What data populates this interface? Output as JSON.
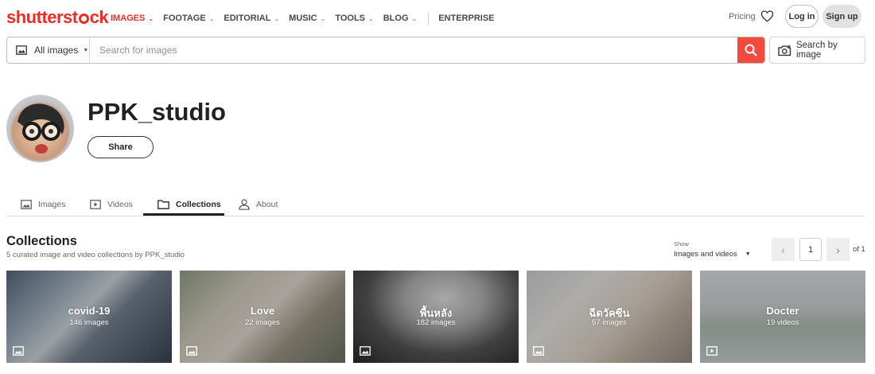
{
  "brand": {
    "logo_text_a": "shutterst",
    "logo_text_b": "ck",
    "accent": "#ee2b24"
  },
  "nav": {
    "items": [
      {
        "label": "IMAGES",
        "has_dropdown": true,
        "active": true
      },
      {
        "label": "FOOTAGE",
        "has_dropdown": true,
        "active": false
      },
      {
        "label": "EDITORIAL",
        "has_dropdown": true,
        "active": false
      },
      {
        "label": "MUSIC",
        "has_dropdown": true,
        "active": false
      },
      {
        "label": "TOOLS",
        "has_dropdown": true,
        "active": false
      },
      {
        "label": "BLOG",
        "has_dropdown": true,
        "active": false
      }
    ],
    "enterprise": "ENTERPRISE",
    "pricing": "Pricing",
    "favorites_icon": "heart-icon",
    "login": "Log in",
    "signup": "Sign up"
  },
  "search": {
    "type_label": "All images",
    "type_icon": "image-icon",
    "placeholder": "Search for images",
    "value": "",
    "button_icon": "search-icon",
    "button_color": "#f24a3c",
    "by_image_label": "Search by image",
    "by_image_icon": "camera-icon"
  },
  "profile": {
    "name": "PPK_studio",
    "share_label": "Share"
  },
  "tabs": [
    {
      "label": "Images",
      "icon": "image-icon",
      "active": false
    },
    {
      "label": "Videos",
      "icon": "video-icon",
      "active": false
    },
    {
      "label": "Collections",
      "icon": "folder-icon",
      "active": true
    },
    {
      "label": "About",
      "icon": "person-icon",
      "active": false
    }
  ],
  "collections": {
    "title": "Collections",
    "subtitle": "5 curated image and video collections by PPK_studio",
    "show_label": "Show",
    "show_value": "Images and videos",
    "pagination": {
      "current": "1",
      "of_label": "of 1"
    },
    "items": [
      {
        "name": "covid-19",
        "count": "146 images",
        "type_icon": "image-icon"
      },
      {
        "name": "Love",
        "count": "22 images",
        "type_icon": "image-icon"
      },
      {
        "name": "พื้นหลัง",
        "count": "182 images",
        "type_icon": "image-icon"
      },
      {
        "name": "ฉีดวัคซีน",
        "count": "57 images",
        "type_icon": "image-icon"
      },
      {
        "name": "Docter",
        "count": "19 videos",
        "type_icon": "video-icon"
      }
    ]
  }
}
